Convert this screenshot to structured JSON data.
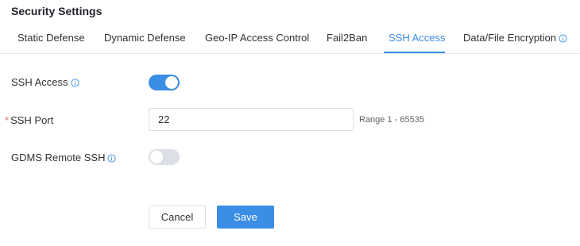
{
  "page": {
    "title": "Security Settings"
  },
  "tabs": [
    {
      "label": "Static Defense",
      "active": false
    },
    {
      "label": "Dynamic Defense",
      "active": false
    },
    {
      "label": "Geo-IP Access Control",
      "active": false
    },
    {
      "label": "Fail2Ban",
      "active": false
    },
    {
      "label": "SSH Access",
      "active": true
    },
    {
      "label": "Data/File Encryption",
      "active": false,
      "icon": "info-icon"
    }
  ],
  "form": {
    "ssh_access": {
      "label": "SSH Access",
      "enabled": true,
      "icon": "info-icon"
    },
    "ssh_port": {
      "required_mark": "*",
      "label": "SSH Port",
      "value": "22",
      "hint": "Range 1 - 65535"
    },
    "gdms_remote_ssh": {
      "label": "GDMS Remote SSH",
      "enabled": false,
      "icon": "info-icon"
    }
  },
  "actions": {
    "cancel_label": "Cancel",
    "save_label": "Save"
  },
  "colors": {
    "accent": "#3a8ee6",
    "required": "#f56c6c",
    "switch_off": "#dcdfe6"
  }
}
